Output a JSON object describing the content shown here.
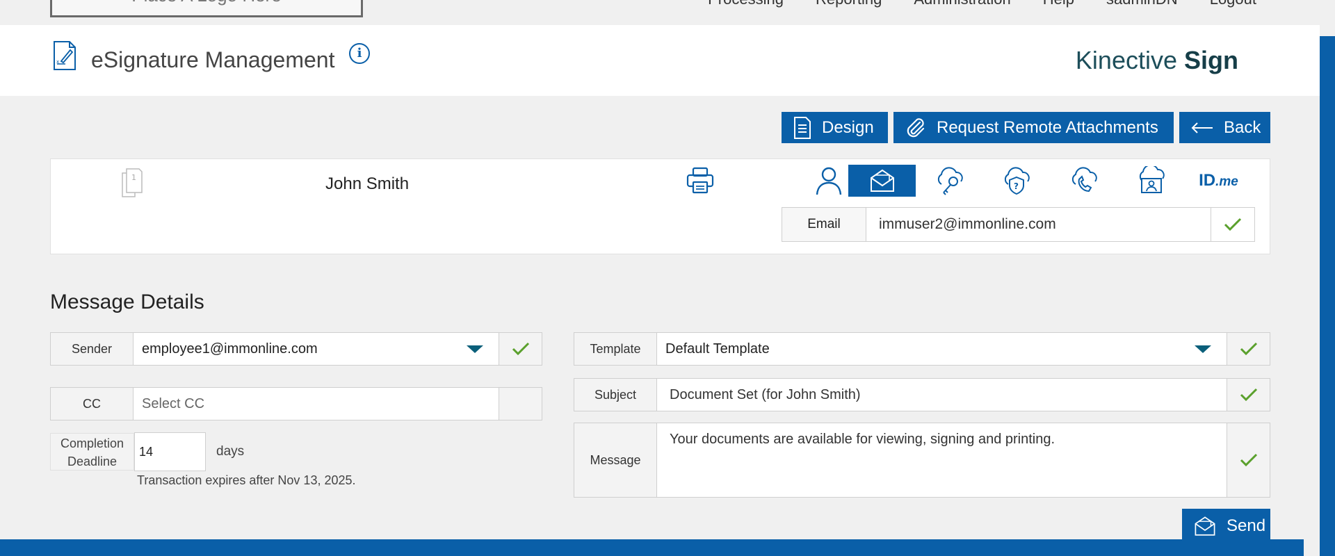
{
  "topnav": {
    "logo_text": "Place A Logo Here",
    "links": [
      "Processing",
      "Reporting",
      "Administration",
      "Help",
      "sadminDN",
      "Logout"
    ]
  },
  "header": {
    "title": "eSignature Management",
    "brand_regular": "Kinective ",
    "brand_bold": "Sign"
  },
  "actions": {
    "design": "Design",
    "remote_attachments": "Request Remote Attachments",
    "back": "Back",
    "send": "Send"
  },
  "recipient": {
    "page_count": "1",
    "name": "John Smith",
    "auth_methods": [
      "person-icon",
      "email-icon",
      "cloud-key-icon",
      "security-question-icon",
      "phone-cloud-icon",
      "id-card-icon",
      "idme-logo"
    ],
    "active_method": "email-icon",
    "idme_text": "ID",
    "idme_suffix": ".me",
    "email_label": "Email",
    "email_value": "immuser2@immonline.com"
  },
  "message_details": {
    "title": "Message Details",
    "sender_label": "Sender",
    "sender_value": "employee1@immonline.com",
    "cc_label": "CC",
    "cc_placeholder": "Select CC",
    "deadline_label_line1": "Completion",
    "deadline_label_line2": "Deadline",
    "deadline_value": "14",
    "deadline_unit": "days",
    "expires_note": "Transaction expires after Nov 13, 2025.",
    "template_label": "Template",
    "template_value": "Default Template",
    "subject_label": "Subject",
    "subject_value": "Document Set (for John Smith)",
    "message_label": "Message",
    "message_value": "Your documents are available for viewing, signing and printing."
  },
  "colors": {
    "primary": "#0a5fa8",
    "check": "#5aa02c",
    "brand_text": "#1d4e5a"
  }
}
